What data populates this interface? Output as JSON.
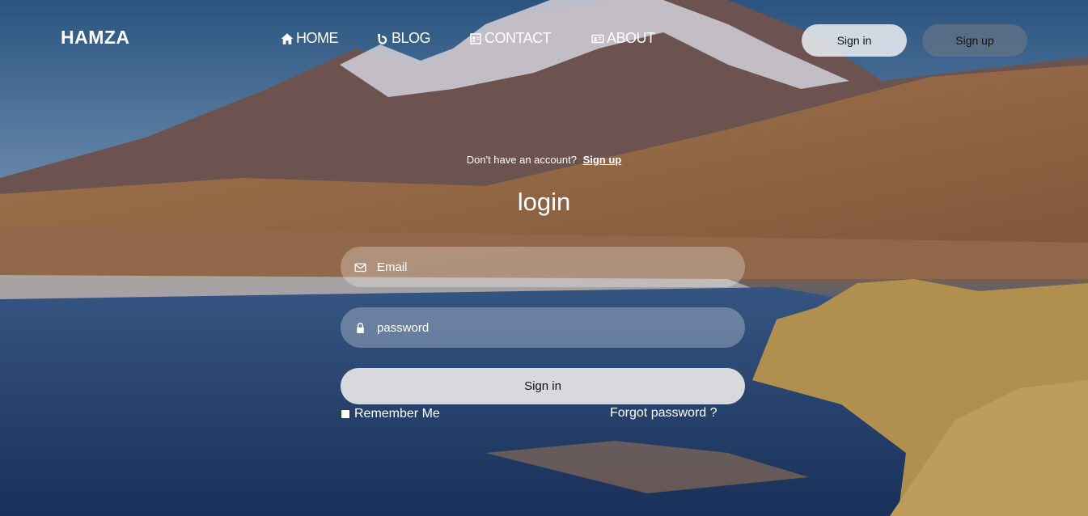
{
  "brand": "HAMZA",
  "nav": {
    "items": [
      {
        "label": "HOME",
        "icon": "home-icon"
      },
      {
        "label": "BLOG",
        "icon": "blog-icon"
      },
      {
        "label": "CONTACT",
        "icon": "contact-icon"
      },
      {
        "label": "ABOUT",
        "icon": "about-icon"
      }
    ],
    "signin_label": "Sign in",
    "signup_label": "Sign up"
  },
  "form": {
    "prompt": "Don't have an account?",
    "prompt_link": "Sign up",
    "title": "login",
    "email_placeholder": "Email",
    "password_placeholder": "password",
    "submit_label": "Sign in",
    "remember_label": "Remember Me",
    "forgot_label": "Forgot password ?"
  },
  "colors": {
    "text": "#ffffff",
    "button_text": "#111111"
  }
}
